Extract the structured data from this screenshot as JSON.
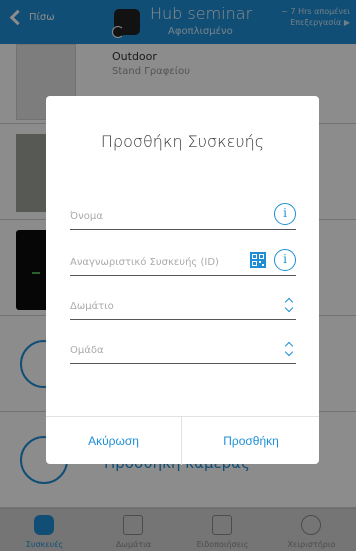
{
  "header": {
    "back_label": "Πίσω",
    "hub_name": "Hub seminar",
    "hub_status": "Αφοπλισμένο",
    "right_line1": "~ 7 Hrs απομένει",
    "right_line2": "Επεξεργασία ▶"
  },
  "devices": {
    "row1_title": "Outdoor",
    "row1_sub": "Stand Γραφείου",
    "camera_label": "Προσθήκη κάμερας"
  },
  "dialog": {
    "title": "Προσθήκη Συσκευής",
    "name_placeholder": "Όνομα",
    "id_placeholder": "Αναγνωριστικό Συσκευής (ID)",
    "room_placeholder": "Δωμάτιο",
    "group_placeholder": "Ομάδα",
    "cancel_label": "Ακύρωση",
    "add_label": "Προσθήκη"
  },
  "tabs": [
    {
      "label": "Συσκευές"
    },
    {
      "label": "Δωμάτια"
    },
    {
      "label": "Ειδοποιήσεις"
    },
    {
      "label": "Χειριστήριο"
    }
  ],
  "colors": {
    "accent": "#1e8fd6",
    "overlay": "rgba(0,0,0,0.45)"
  }
}
